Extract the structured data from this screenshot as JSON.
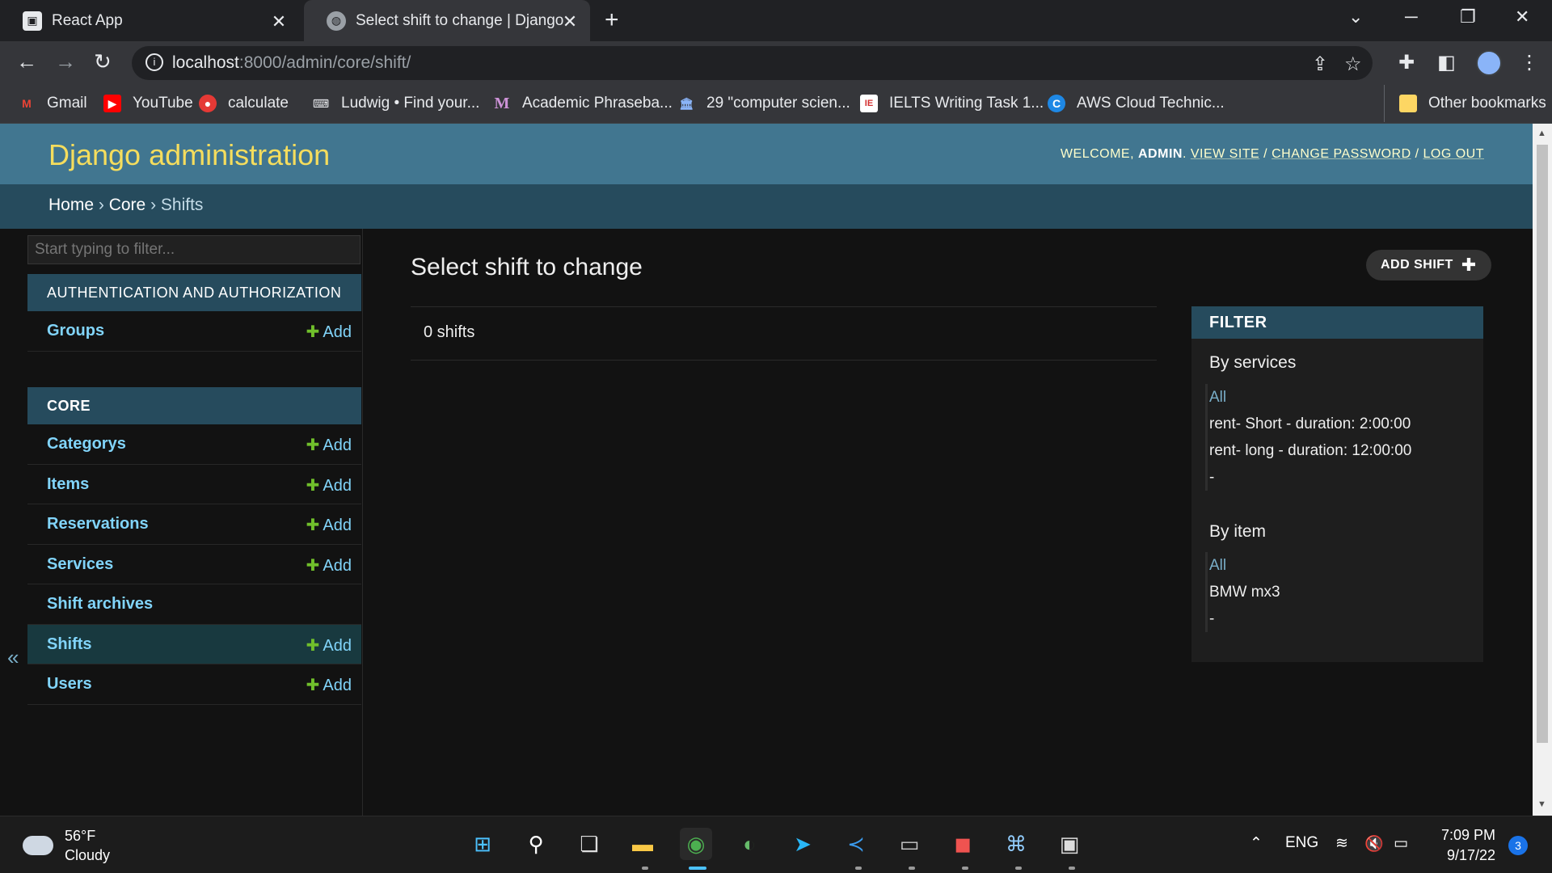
{
  "browser": {
    "tabs": [
      {
        "title": "React App",
        "active": false
      },
      {
        "title": "Select shift to change | Django si",
        "active": true
      }
    ],
    "url_host": "localhost",
    "url_path": ":8000/admin/core/shift/",
    "bookmarks": [
      {
        "label": "Gmail",
        "icon": "gmail-icon",
        "color": "#ea4335"
      },
      {
        "label": "YouTube",
        "icon": "youtube-icon",
        "color": "#ff0000"
      },
      {
        "label": "calculate",
        "icon": "calculate-icon",
        "color": "#e53935"
      },
      {
        "label": "Ludwig • Find your...",
        "icon": "ludwig-icon",
        "color": "#e8eaed"
      },
      {
        "label": "Academic Phraseba...",
        "icon": "academic-phrasebank-icon",
        "color": "#7b1fa2"
      },
      {
        "label": "29 \"computer scien...",
        "icon": "institution-icon",
        "color": "#8ab4f8"
      },
      {
        "label": "IELTS Writing Task 1...",
        "icon": "ielts-icon",
        "color": "#d32f2f"
      },
      {
        "label": "AWS Cloud Technic...",
        "icon": "coursera-icon",
        "color": "#1e88e5"
      }
    ],
    "other_bookmarks": "Other bookmarks"
  },
  "header": {
    "brand": "Django administration",
    "welcome": "Welcome,",
    "user": "admin",
    "view_site": "View site",
    "change_password": "Change password",
    "log_out": "Log out"
  },
  "breadcrumbs": {
    "home": "Home",
    "app": "Core",
    "current": "Shifts"
  },
  "sidebar": {
    "filter_placeholder": "Start typing to filter...",
    "collapse_glyph": "«",
    "add_label": "Add",
    "auth_caption": "Authentication and Authorization",
    "auth_models": [
      {
        "name": "Groups",
        "has_add": true
      }
    ],
    "core_caption": "Core",
    "core_models": [
      {
        "name": "Categorys",
        "has_add": true
      },
      {
        "name": "Items",
        "has_add": true
      },
      {
        "name": "Reservations",
        "has_add": true
      },
      {
        "name": "Services",
        "has_add": true
      },
      {
        "name": "Shift archives",
        "has_add": false
      },
      {
        "name": "Shifts",
        "has_add": true,
        "current": true
      },
      {
        "name": "Users",
        "has_add": true
      }
    ]
  },
  "main": {
    "title": "Select shift to change",
    "add_button": "Add shift",
    "result_count": "0 shifts"
  },
  "filter": {
    "title": "Filter",
    "groups": [
      {
        "title": "By services",
        "options": [
          "All",
          "rent- Short - duration: 2:00:00",
          "rent- long - duration: 12:00:00",
          "-"
        ]
      },
      {
        "title": "By item",
        "options": [
          "All",
          "BMW mx3",
          "-"
        ]
      }
    ]
  },
  "taskbar": {
    "temperature": "56°F",
    "condition": "Cloudy",
    "language": "ENG",
    "time": "7:09 PM",
    "date": "9/17/22",
    "notifications": "3"
  },
  "colors": {
    "header_bg": "#417690",
    "brand": "#f5dd5d",
    "breadcrumb_bg": "#264b5d",
    "link": "#81d4fa",
    "add_plus": "#70bf2b"
  }
}
